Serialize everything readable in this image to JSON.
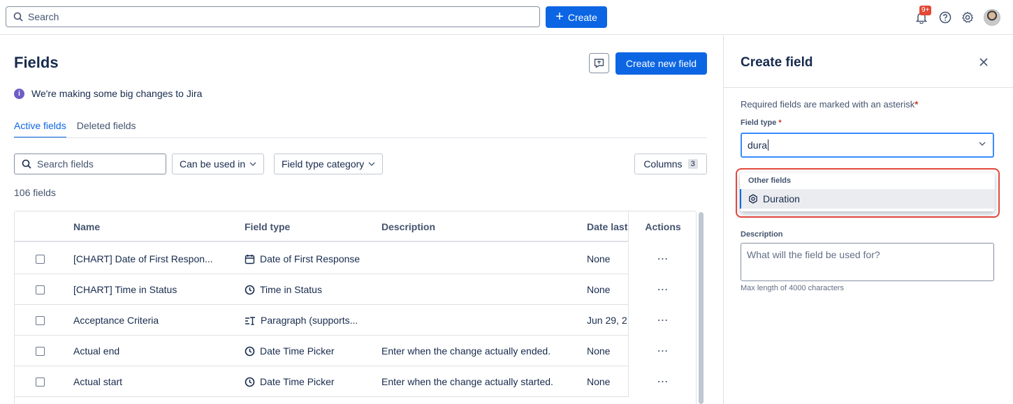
{
  "topbar": {
    "search_placeholder": "Search",
    "create_label": "Create",
    "notifications_badge": "9+"
  },
  "page": {
    "title": "Fields",
    "new_field_button": "Create new field",
    "info_banner": "We're making some big changes to Jira"
  },
  "tabs": [
    {
      "label": "Active fields",
      "active": true
    },
    {
      "label": "Deleted fields",
      "active": false
    }
  ],
  "filters": {
    "search_placeholder": "Search fields",
    "can_be_used_in": "Can be used in",
    "field_type_category": "Field type category",
    "columns_label": "Columns",
    "columns_count": "3"
  },
  "field_count": "106 fields",
  "table": {
    "headers": {
      "name": "Name",
      "type": "Field type",
      "description": "Description",
      "date": "Date last",
      "actions": "Actions"
    },
    "rows": [
      {
        "name": "[CHART] Date of First Respon...",
        "type_icon": "calendar-icon",
        "type": "Date of First Response",
        "description": "",
        "date": "None"
      },
      {
        "name": "[CHART] Time in Status",
        "type_icon": "clock-icon",
        "type": "Time in Status",
        "description": "",
        "date": "None"
      },
      {
        "name": "Acceptance Criteria",
        "type_icon": "paragraph-icon",
        "type": "Paragraph (supports...",
        "description": "",
        "date": "Jun 29, 2"
      },
      {
        "name": "Actual end",
        "type_icon": "clock-icon",
        "type": "Date Time Picker",
        "description": "Enter when the change actually ended.",
        "date": "None"
      },
      {
        "name": "Actual start",
        "type_icon": "clock-icon",
        "type": "Date Time Picker",
        "description": "Enter when the change actually started.",
        "date": "None"
      }
    ]
  },
  "panel": {
    "title": "Create field",
    "required_note": "Required fields are marked with an asterisk",
    "field_type_label": "Field type",
    "field_type_value": "dura",
    "dropdown_group": "Other fields",
    "dropdown_option": "Duration",
    "description_label": "Description",
    "description_placeholder": "What will the field be used for?",
    "description_hint": "Max length of 4000 characters"
  },
  "colors": {
    "accent": "#0c66e4",
    "highlight": "#e2483d",
    "info": "#6e5dc6"
  }
}
